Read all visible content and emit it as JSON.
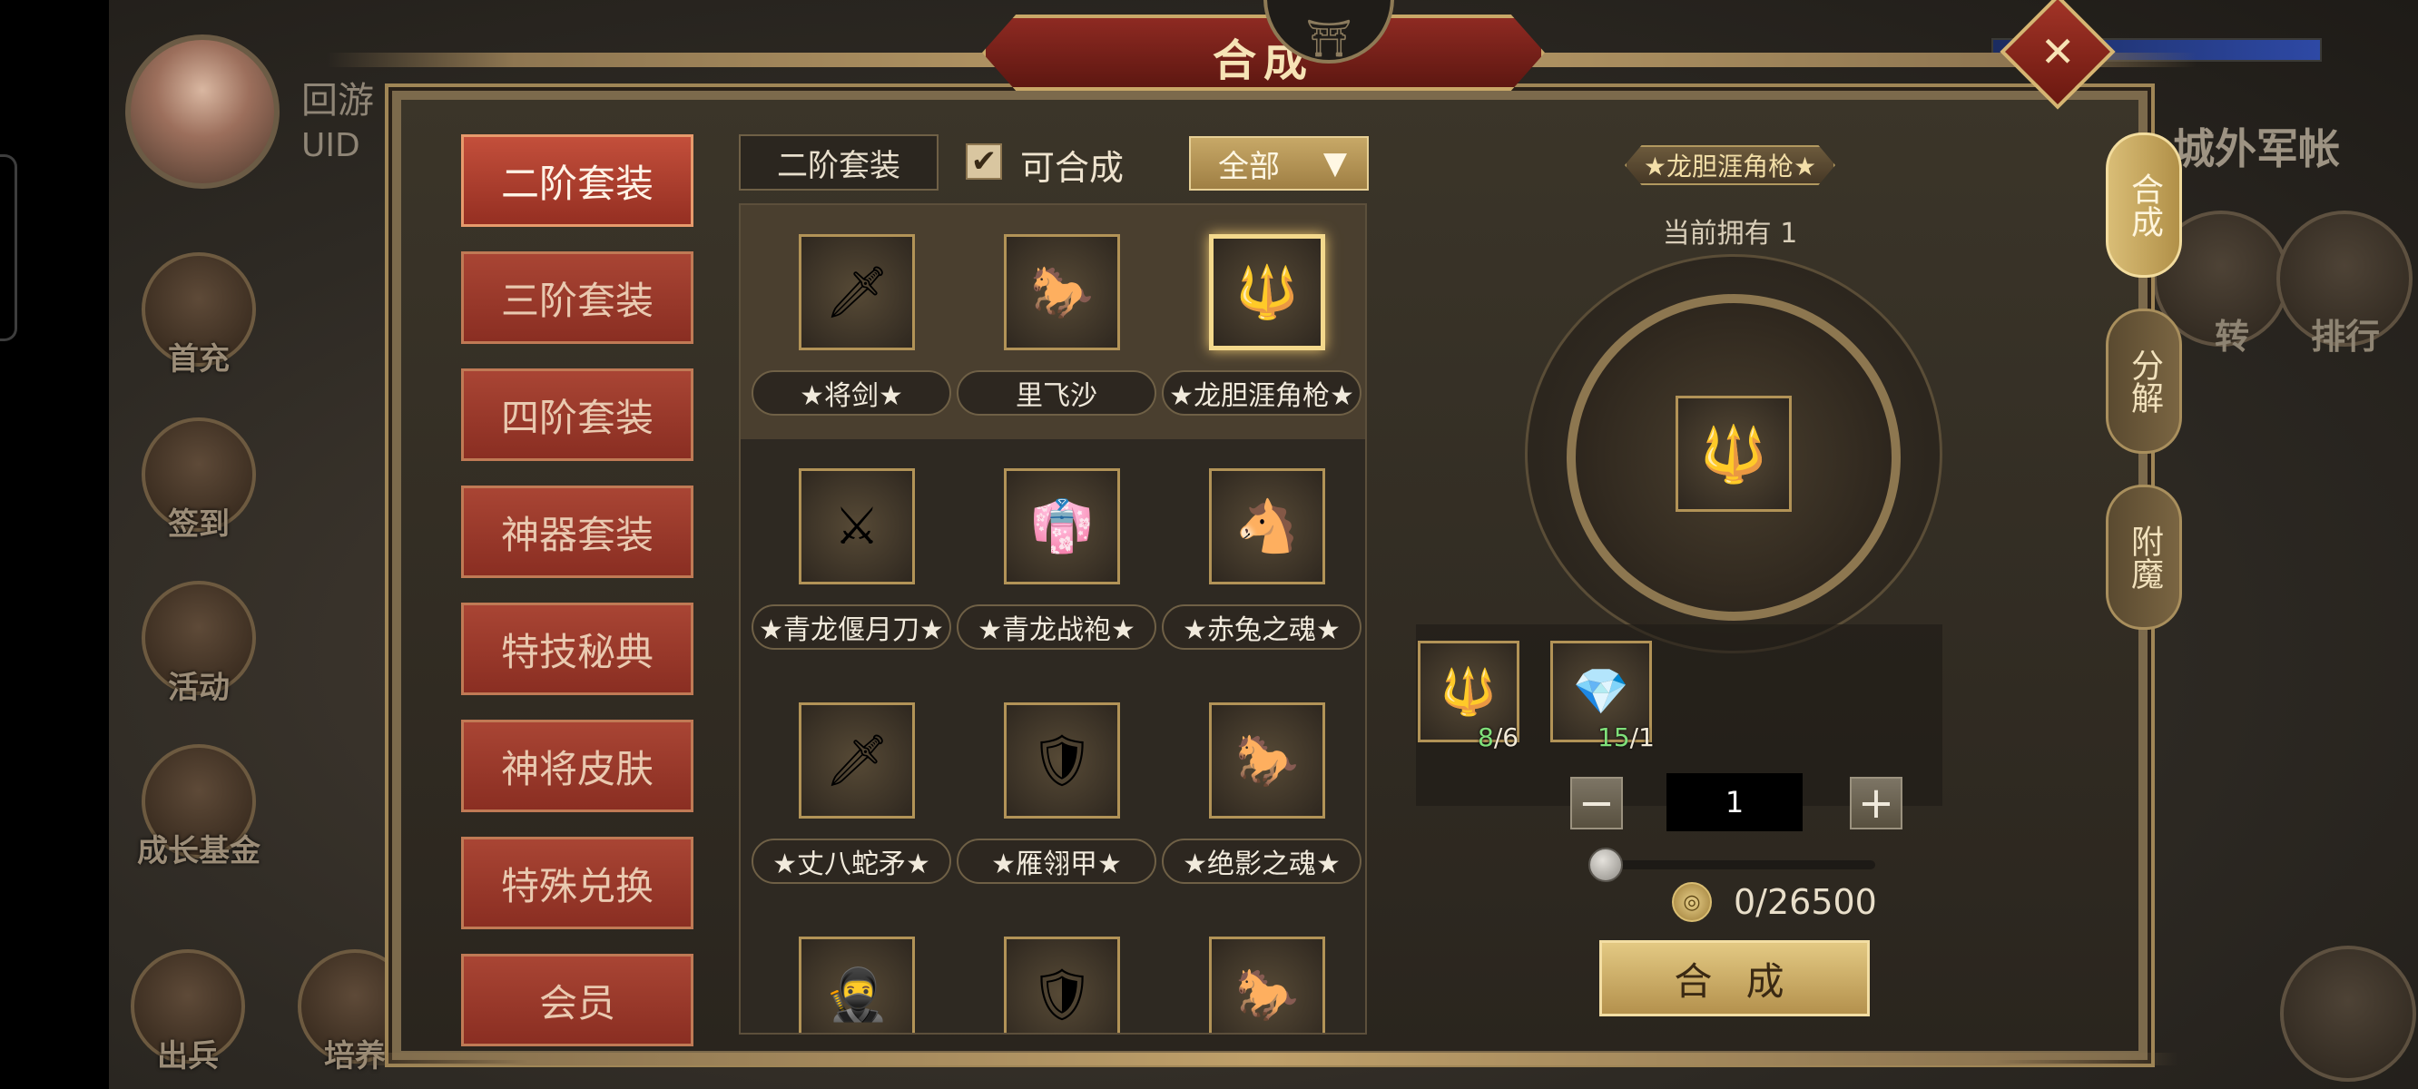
{
  "player": {
    "name": "回游",
    "uid_label": "UID"
  },
  "left_menu": [
    {
      "label": "首充",
      "icon": "gift-icon"
    },
    {
      "label": "签到",
      "icon": "calendar-icon"
    },
    {
      "label": "活动",
      "icon": "flower-icon"
    },
    {
      "label": "成长基金",
      "icon": "plant-icon"
    },
    {
      "label": "出兵",
      "icon": "flag-icon"
    },
    {
      "label": "培养",
      "icon": "helmet-icon"
    }
  ],
  "dialog": {
    "title": "合成",
    "categories": [
      {
        "label": "二阶套装",
        "active": true
      },
      {
        "label": "三阶套装",
        "active": false
      },
      {
        "label": "四阶套装",
        "active": false
      },
      {
        "label": "神器套装",
        "active": false
      },
      {
        "label": "特技秘典",
        "active": false
      },
      {
        "label": "神将皮肤",
        "active": false
      },
      {
        "label": "特殊兑换",
        "active": false
      },
      {
        "label": "会员",
        "active": false
      }
    ],
    "filter": {
      "tier_tag": "二阶套装",
      "checkbox_label": "可合成",
      "checked": true,
      "dropdown_value": "全部"
    },
    "items": [
      {
        "name": "★将剑★",
        "icon": "sword-icon",
        "glyph": "🗡"
      },
      {
        "name": "里飞沙",
        "icon": "horse-icon",
        "glyph": "🐎"
      },
      {
        "name": "★龙胆涯角枪★",
        "icon": "spear-icon",
        "glyph": "🔱",
        "selected": true
      },
      {
        "name": "★青龙偃月刀★",
        "icon": "glaive-icon",
        "glyph": "⚔"
      },
      {
        "name": "★青龙战袍★",
        "icon": "robe-icon",
        "glyph": "👘"
      },
      {
        "name": "★赤兔之魂★",
        "icon": "red-horse-icon",
        "glyph": "🐴"
      },
      {
        "name": "★丈八蛇矛★",
        "icon": "serpent-spear-icon",
        "glyph": "🗡"
      },
      {
        "name": "★雁翎甲★",
        "icon": "armor-icon",
        "glyph": "🛡"
      },
      {
        "name": "★绝影之魂★",
        "icon": "dark-horse-icon",
        "glyph": "🐎"
      },
      {
        "name": "",
        "icon": "warrior-icon",
        "glyph": "🥷"
      },
      {
        "name": "",
        "icon": "armor-icon",
        "glyph": "🛡"
      },
      {
        "name": "",
        "icon": "white-horse-icon",
        "glyph": "🐎"
      }
    ],
    "detail": {
      "title": "★龙胆涯角枪★",
      "owned_text": "当前拥有 1",
      "materials": [
        {
          "icon": "spear-fragment-icon",
          "glyph": "🔱",
          "have": "8",
          "need": "/6"
        },
        {
          "icon": "red-gem-icon",
          "glyph": "💎",
          "have": "15",
          "need": "/1"
        }
      ],
      "quantity": "1",
      "slider_fraction": 0,
      "cost": "0/26500",
      "synth_button": "合 成"
    },
    "side_tabs": [
      {
        "label": "合成",
        "active": true
      },
      {
        "label": "分解",
        "active": false
      },
      {
        "label": "附魔",
        "active": false
      }
    ]
  },
  "right_area": {
    "title": "城外军帐",
    "buttons": [
      "转",
      "排行"
    ]
  }
}
